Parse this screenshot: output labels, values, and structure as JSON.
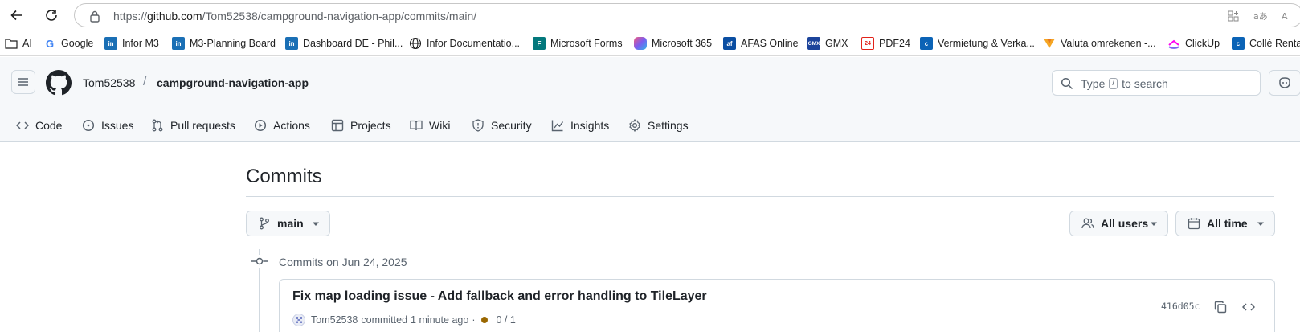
{
  "browser": {
    "url_prefix": "https://",
    "url_host": "github.com",
    "url_path": "/Tom52538/campground-navigation-app/commits/main/",
    "bookmarks": [
      {
        "label": "AI",
        "icon": "folder-icon"
      },
      {
        "label": "Google",
        "icon": "google-icon",
        "color": "#4285f4"
      },
      {
        "label": "Infor M3",
        "icon": "infor-icon",
        "color": "#1a6fb5"
      },
      {
        "label": "M3-Planning Board",
        "icon": "infor-icon",
        "color": "#1a6fb5"
      },
      {
        "label": "Dashboard DE - Phil...",
        "icon": "infor-icon",
        "color": "#1a6fb5"
      },
      {
        "label": "Infor Documentatio...",
        "icon": "globe-icon"
      },
      {
        "label": "Microsoft Forms",
        "icon": "forms-icon",
        "color": "#03787c"
      },
      {
        "label": "Microsoft 365",
        "icon": "m365-icon",
        "color": "#c43bd8"
      },
      {
        "label": "AFAS Online",
        "icon": "afas-icon",
        "color": "#0b4ea2"
      },
      {
        "label": "GMX",
        "icon": "gmx-icon",
        "color": "#1c449b"
      },
      {
        "label": "PDF24",
        "icon": "pdf24-icon",
        "color": "#e2231a"
      },
      {
        "label": "Vermietung & Verka...",
        "icon": "vermietung-icon",
        "color": "#0b63b6"
      },
      {
        "label": "Valuta omrekenen -...",
        "icon": "valuta-icon",
        "color": "#f5a623"
      },
      {
        "label": "ClickUp",
        "icon": "clickup-icon",
        "color": "#7b68ee"
      },
      {
        "label": "Collé Rental",
        "icon": "colle-icon",
        "color": "#0b63b6"
      }
    ]
  },
  "header": {
    "owner": "Tom52538",
    "separator": "/",
    "repo": "campground-navigation-app",
    "search_prefix": "Type",
    "search_key": "/",
    "search_suffix": "to search"
  },
  "tabs": [
    {
      "label": "Code",
      "icon": "code-icon"
    },
    {
      "label": "Issues",
      "icon": "issue-icon"
    },
    {
      "label": "Pull requests",
      "icon": "pull-request-icon"
    },
    {
      "label": "Actions",
      "icon": "play-icon"
    },
    {
      "label": "Projects",
      "icon": "table-icon"
    },
    {
      "label": "Wiki",
      "icon": "book-icon"
    },
    {
      "label": "Security",
      "icon": "shield-icon"
    },
    {
      "label": "Insights",
      "icon": "graph-icon"
    },
    {
      "label": "Settings",
      "icon": "gear-icon"
    }
  ],
  "main": {
    "title": "Commits",
    "branch": "main",
    "users_filter": "All users",
    "time_filter": "All time",
    "group_heading": "Commits on Jun 24, 2025",
    "commit": {
      "title": "Fix map loading issue - Add fallback and error handling to TileLayer",
      "author": "Tom52538",
      "action": "committed",
      "time": "1 minute ago",
      "dot_sep": "·",
      "checks": "0 / 1",
      "sha": "416d05c"
    }
  },
  "colors": {
    "header_bg": "#f6f8fa",
    "border": "#d1d9e0",
    "status_pending": "#9a6700",
    "muted_text": "#59636e"
  }
}
